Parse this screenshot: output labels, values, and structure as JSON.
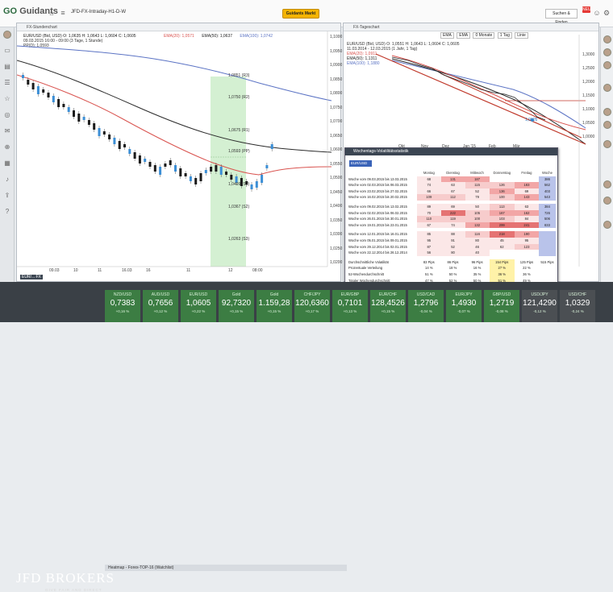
{
  "topbar": {
    "logo_go": "GO",
    "logo_text": "Guidants",
    "tab_title": "JFD-FX-Intraday-H1-D-W",
    "center_button": "Guidants Markt",
    "search_button": "Suchen & Finden",
    "badge": "NEU"
  },
  "left_panel": {
    "title": "FX-Stundenchart",
    "legend": [
      "EUR/USD (Bid, USD) O: 1,0635 H: 1,0643 L: 1,0604 C: 1,0605",
      "EMA(20): 1,0571",
      "EMA(50): 1,0637",
      "EMA(100): 1,0742",
      "09.03.2015 16:00 - 09:00 (3 Tage, 1 Stunde)",
      "PP(D): 1,0593"
    ],
    "fib_labels": [
      "1,0851 (R3)",
      "1,0750 (R2)",
      "1,0675 (R1)",
      "1,0593 (PP)",
      "1,0499 (S1)",
      "1,0367 (S2)",
      "1,0263 (S3)"
    ],
    "price_axis": [
      "1,1000",
      "1,0950",
      "1,0900",
      "1,0850",
      "1,0800",
      "1,0750",
      "1,0700",
      "1,0650",
      "1,0600",
      "1,0550",
      "1,0500",
      "1,0450",
      "1,0400",
      "1,0350",
      "1,0300",
      "1,0250",
      "1,0200"
    ],
    "time_axis": [
      "09.03",
      "10",
      "11",
      "16.03",
      "16",
      "11",
      "12",
      "08:00"
    ],
    "symbol_tag": "EUR/... FX"
  },
  "right_panel": {
    "title": "FX-Tageschart",
    "toolbar": [
      "EMA",
      "EMA",
      "0 Monate",
      "1 Tag",
      "Linie"
    ],
    "legend": [
      "EUR/USD (Bid, USD) O: 1,0551 H: 1,0643 L: 1,0604 C: 1,0605",
      "11.03.2014 - 12.03.2015 (1 Jahr, 1 Tag)",
      "EMA(20): 1,0911",
      "EMA(50): 1,1311",
      "EMA(100): 1,1880"
    ],
    "price_axis": [
      "1,3000",
      "1,2500",
      "1,2000",
      "1,1500",
      "1,1000",
      "1,0500",
      "1,0000"
    ],
    "time_axis": [
      "Okt",
      "Nov",
      "Dez",
      "Jan '15",
      "Feb",
      "Mär"
    ],
    "last_price": "1,0605"
  },
  "volatility": {
    "title": "Wochentags-Volatilitätsstatistik",
    "selector": "EUR/USD 7:00",
    "columns": [
      "Montag",
      "Dienstag",
      "Mittwoch",
      "Donnerstag",
      "Freitag",
      "Woche"
    ],
    "rows": [
      {
        "label": "Woche vom 09.03.2015 bis 13.03.2015",
        "values": [
          "68",
          "131",
          "187",
          "",
          "",
          ""
        ],
        "week": "386"
      },
      {
        "label": "Woche vom 02.03.2015 bis 06.03.2015",
        "values": [
          "74",
          "63",
          "115",
          "126",
          "183"
        ],
        "week": "562"
      },
      {
        "label": "Woche vom 23.02.2015 bis 27.02.2015",
        "values": [
          "66",
          "67",
          "52",
          "136",
          "69"
        ],
        "week": "403"
      },
      {
        "label": "Woche vom 16.02.2015 bis 20.02.2015",
        "values": [
          "109",
          "112",
          "79",
          "100",
          "143"
        ],
        "week": "543"
      },
      {
        "gap": true
      },
      {
        "label": "Woche vom 09.02.2015 bis 13.02.2015",
        "values": [
          "89",
          "69",
          "50",
          "113",
          "63"
        ],
        "week": "384"
      },
      {
        "label": "Woche vom 02.02.2015 bis 06.02.2015",
        "values": [
          "70",
          "222",
          "105",
          "167",
          "162"
        ],
        "week": "726"
      },
      {
        "label": "Woche vom 26.01.2015 bis 30.01.2015",
        "values": [
          "110",
          "119",
          "100",
          "103",
          "84"
        ],
        "week": "506"
      },
      {
        "label": "Woche vom 19.01.2015 bis 23.01.2015",
        "values": [
          "67",
          "74",
          "132",
          "299",
          "241"
        ],
        "week": "833"
      },
      {
        "gap": true
      },
      {
        "label": "Woche vom 12.01.2015 bis 16.01.2015",
        "values": [
          "85",
          "88",
          "116",
          "218",
          "190"
        ],
        "week": ""
      },
      {
        "label": "Woche vom 05.01.2015 bis 09.01.2015",
        "values": [
          "95",
          "91",
          "80",
          "45",
          "95"
        ],
        "week": ""
      },
      {
        "label": "Woche vom 29.12.2014 bis 02.01.2015",
        "values": [
          "87",
          "52",
          "46",
          "62",
          "123"
        ],
        "week": ""
      },
      {
        "label": "Woche vom 22.12.2014 bis 26.12.2014",
        "values": [
          "56",
          "80",
          "40",
          "",
          ""
        ],
        "week": ""
      },
      {
        "gap": true
      },
      {
        "label": "Durchschnittliche Volatilität",
        "values": [
          "83 Pips",
          "86 Pips",
          "96 Pips",
          "154 Pips",
          "125 Pips"
        ],
        "week": "515 Pips"
      },
      {
        "label": "Prozentuale Verteilung",
        "values": [
          "14 %",
          "18 %",
          "16 %",
          "27 %",
          "22 %"
        ],
        "week": ""
      },
      {
        "label": "52-Wochendurchschnitt",
        "values": [
          "51 %",
          "50 %",
          "35 %",
          "36 %",
          "36 %"
        ],
        "week": ""
      },
      {
        "label": "Totaler Wochendurchschnitt",
        "values": [
          "47 %",
          "52 %",
          "50 %",
          "51 %",
          "49 %"
        ],
        "week": ""
      }
    ]
  },
  "bottom": {
    "strip_title": "Heatmap - Forex-TOP-16 (Watchlist)",
    "brand": "JFD BROKERS",
    "brand_sub": "GIVE FAIR AND DIRECT",
    "quotes": [
      {
        "name": "NZD/USD",
        "value": "0,7383",
        "change": "+0,16 %",
        "pos": true
      },
      {
        "name": "AUD/USD",
        "value": "0,7656",
        "change": "+0,12 %",
        "pos": true
      },
      {
        "name": "EUR/USD",
        "value": "1,0605",
        "change": "+0,22 %",
        "pos": true
      },
      {
        "name": "Gold",
        "value": "92,7320",
        "change": "+0,15 %",
        "pos": true
      },
      {
        "name": "Gold",
        "value": "1.159,28",
        "change": "+0,15 %",
        "pos": true
      },
      {
        "name": "CHF/JPY",
        "value": "120,6360",
        "change": "+0,17 %",
        "pos": true
      },
      {
        "name": "EUR/GBP",
        "value": "0,7101",
        "change": "+0,13 %",
        "pos": true
      },
      {
        "name": "EUR/CHF",
        "value": "128,4526",
        "change": "+0,15 %",
        "pos": true
      },
      {
        "name": "USD/CAD",
        "value": "1,2796",
        "change": "-0,04 %",
        "pos": true
      },
      {
        "name": "EUR/JPY",
        "value": "1,4930",
        "change": "-0,07 %",
        "pos": true
      },
      {
        "name": "GBP/USD",
        "value": "1,2719",
        "change": "-0,08 %",
        "pos": true
      },
      {
        "name": "USD/JPY",
        "value": "121,4290",
        "change": "-0,12 %",
        "pos": false
      },
      {
        "name": "USD/CHF",
        "value": "1,0329",
        "change": "-0,24 %",
        "pos": false
      }
    ]
  },
  "colors": {
    "ema20": "#d9534f",
    "ema50": "#2b2b2b",
    "ema100": "#5b73c4",
    "fib_zone": "#cfeecd",
    "bull": "#3c8fd6",
    "bear": "#1a1a1a"
  }
}
